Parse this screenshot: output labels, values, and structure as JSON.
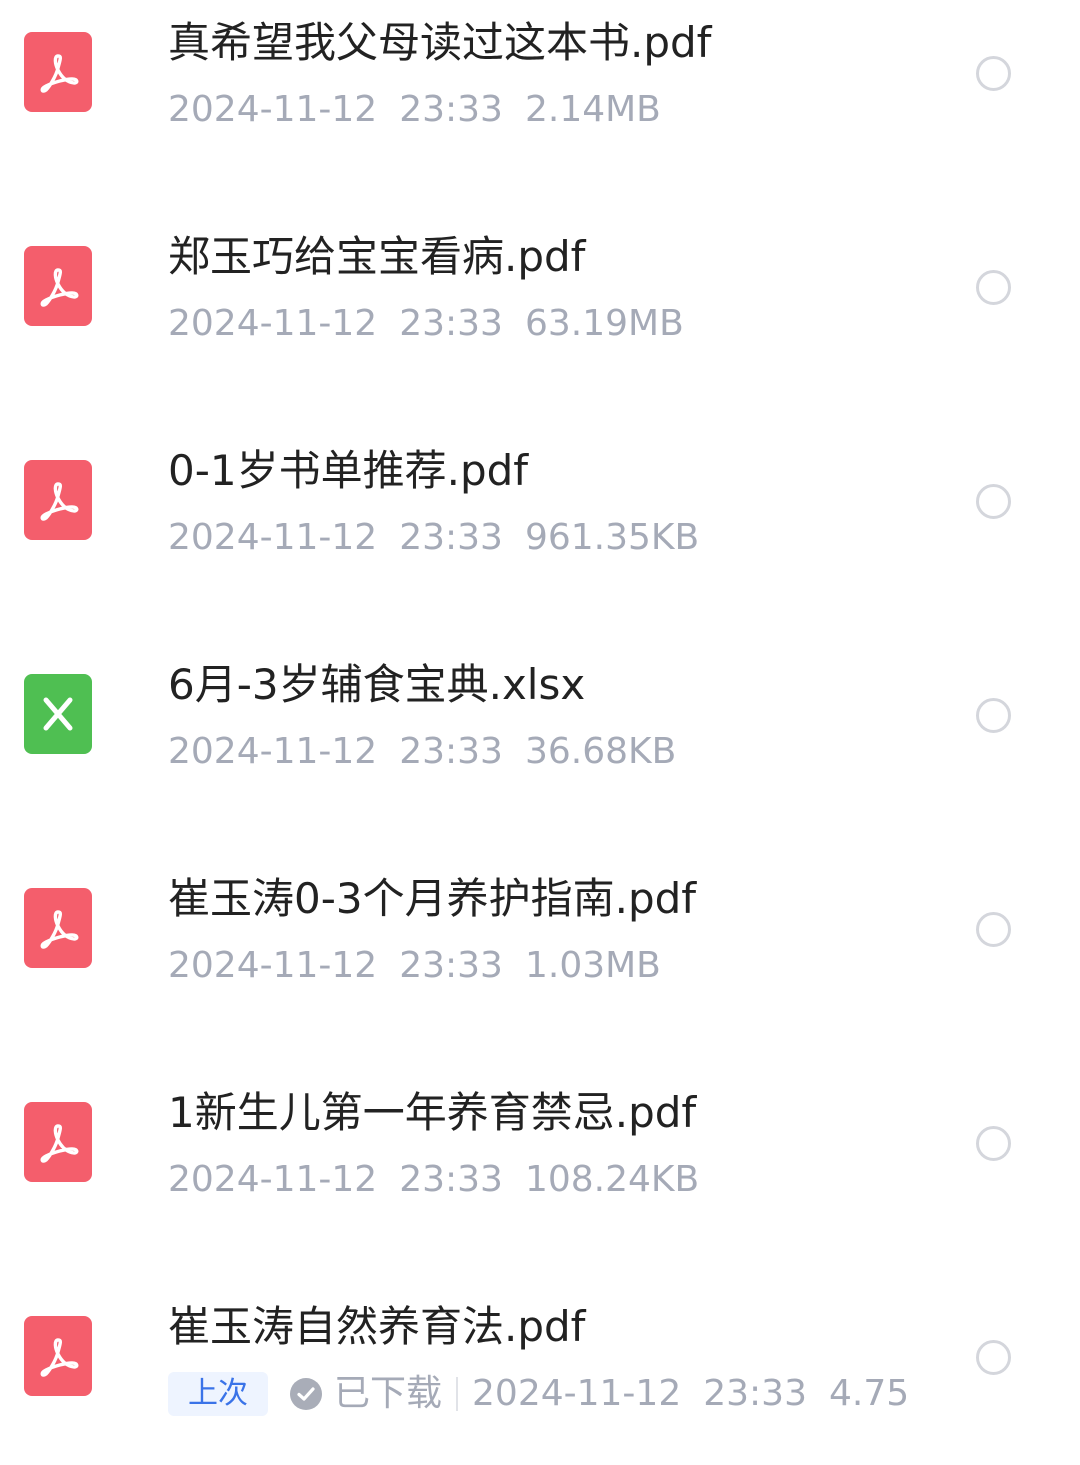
{
  "files": [
    {
      "type": "pdf",
      "icon": "pdf-file-icon",
      "name": "真希望我父母读过这本书.pdf",
      "date": "2024-11-12",
      "time": "23:33",
      "size": "2.14MB"
    },
    {
      "type": "pdf",
      "icon": "pdf-file-icon",
      "name": "郑玉巧给宝宝看病.pdf",
      "date": "2024-11-12",
      "time": "23:33",
      "size": "63.19MB"
    },
    {
      "type": "pdf",
      "icon": "pdf-file-icon",
      "name": "0-1岁书单推荐.pdf",
      "date": "2024-11-12",
      "time": "23:33",
      "size": "961.35KB"
    },
    {
      "type": "xlsx",
      "icon": "excel-file-icon",
      "name": "6月-3岁辅食宝典.xlsx",
      "date": "2024-11-12",
      "time": "23:33",
      "size": "36.68KB"
    },
    {
      "type": "pdf",
      "icon": "pdf-file-icon",
      "name": "崔玉涛0-3个月养护指南.pdf",
      "date": "2024-11-12",
      "time": "23:33",
      "size": "1.03MB"
    },
    {
      "type": "pdf",
      "icon": "pdf-file-icon",
      "name": "1新生儿第一年养育禁忌.pdf",
      "date": "2024-11-12",
      "time": "23:33",
      "size": "108.24KB"
    },
    {
      "type": "pdf",
      "icon": "pdf-file-icon",
      "name": "崔玉涛自然养育法.pdf",
      "date": "2024-11-12",
      "time": "23:33",
      "size": "4.75",
      "badge": "上次",
      "status": "已下载",
      "status_icon": "check-circle-icon"
    }
  ],
  "colors": {
    "pdf": "#f45e6c",
    "xlsx": "#4fbf52",
    "name_text": "#222222",
    "meta_text": "#a5aab7",
    "badge_text": "#3a73e8",
    "badge_bg": "#eef4ff"
  }
}
